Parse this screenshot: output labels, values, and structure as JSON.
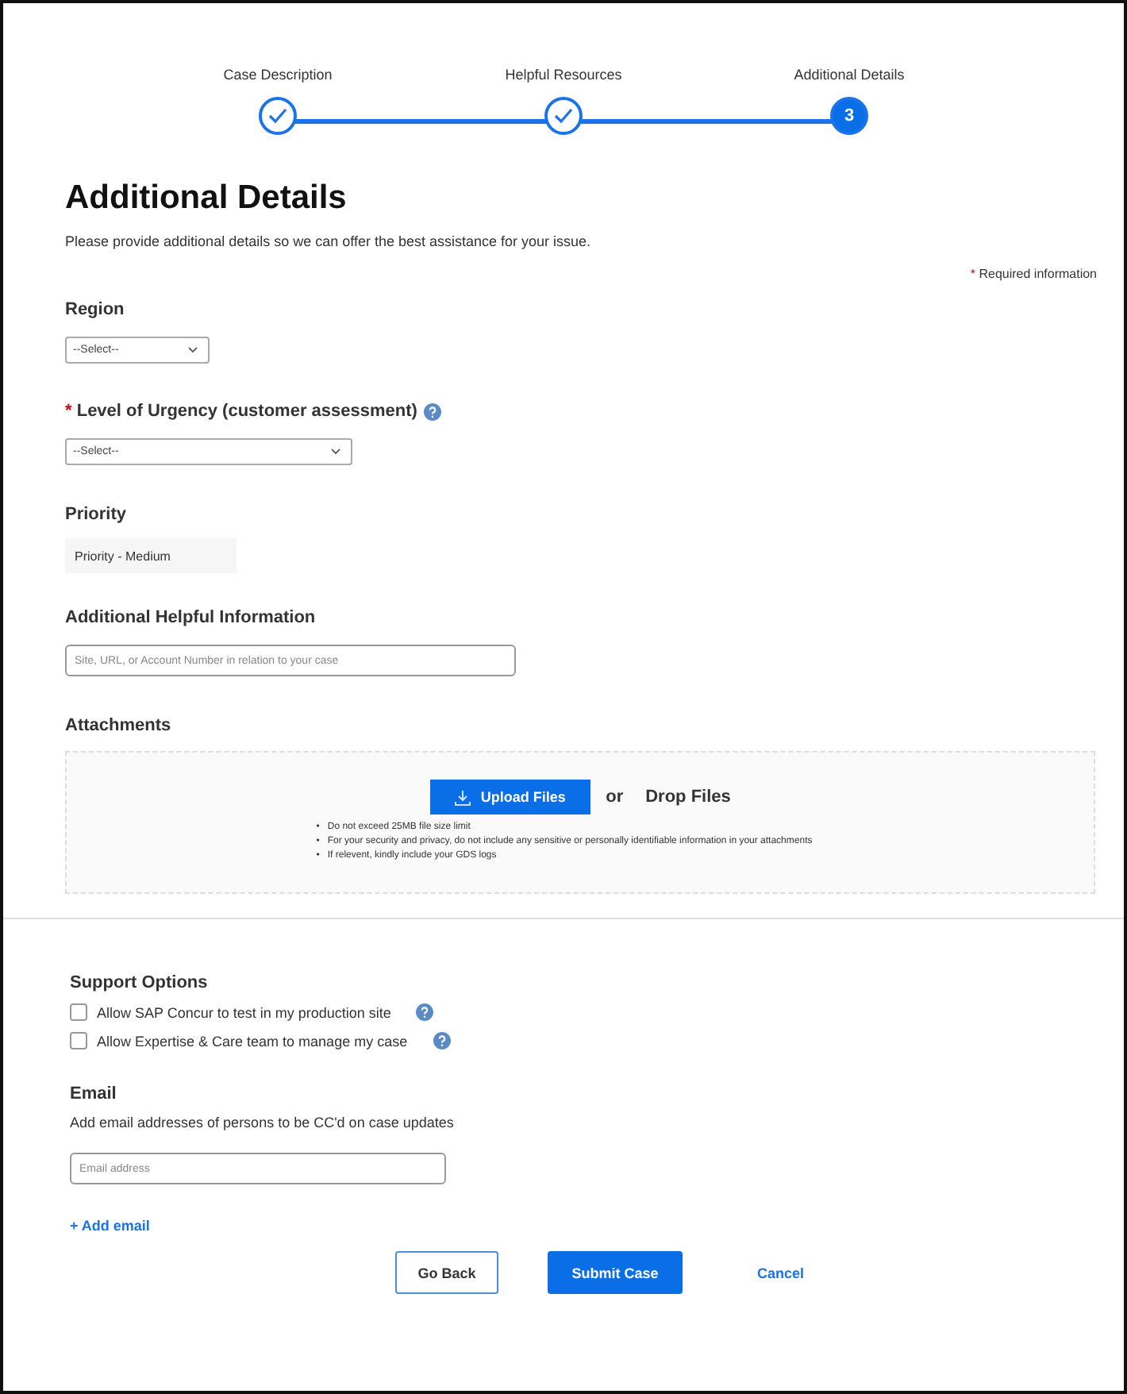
{
  "steps": [
    {
      "label": "Case Description",
      "completed": true
    },
    {
      "label": "Helpful Resources",
      "completed": true
    },
    {
      "label": "Additional Details",
      "completed": false,
      "number": "3"
    }
  ],
  "heading": "Additional Details",
  "description": "Please provide additional details so we can offer the best assistance for your issue.",
  "required_note": {
    "mark": "*",
    "text": "Required information"
  },
  "region": {
    "label": "Region",
    "value": "--Select--"
  },
  "urgency": {
    "label": "Level of Urgency (customer assessment)",
    "required": true,
    "value": "--Select--"
  },
  "priority": {
    "label": "Priority",
    "value": "Priority - Medium"
  },
  "helpful_info": {
    "label": "Additional Helpful Information",
    "placeholder": "Site, URL, or Account Number in relation to your case"
  },
  "attachments": {
    "label": "Attachments",
    "upload_button": "Upload Files",
    "or": "or",
    "drop": "Drop Files",
    "notes": [
      {
        "bullet": "•",
        "text": "Do not exceed 25MB file size limit"
      },
      {
        "bullet": "•",
        "text": "For your security and privacy, do not include any sensitive or personally identifiable information in your attachments"
      },
      {
        "bullet": "•",
        "text": "If relevent, kindly include your GDS logs"
      }
    ]
  },
  "support_options": {
    "label": "Support Options",
    "options": [
      {
        "label": "Allow SAP Concur to test in my production site",
        "checked": false
      },
      {
        "label": "Allow Expertise & Care team to manage my case",
        "checked": false
      }
    ]
  },
  "email": {
    "label": "Email",
    "hint": "Add email addresses of persons to be CC'd on case updates",
    "placeholder": "Email address",
    "add": "+ Add email"
  },
  "buttons": {
    "back": "Go Back",
    "submit": "Submit Case",
    "cancel": "Cancel"
  }
}
